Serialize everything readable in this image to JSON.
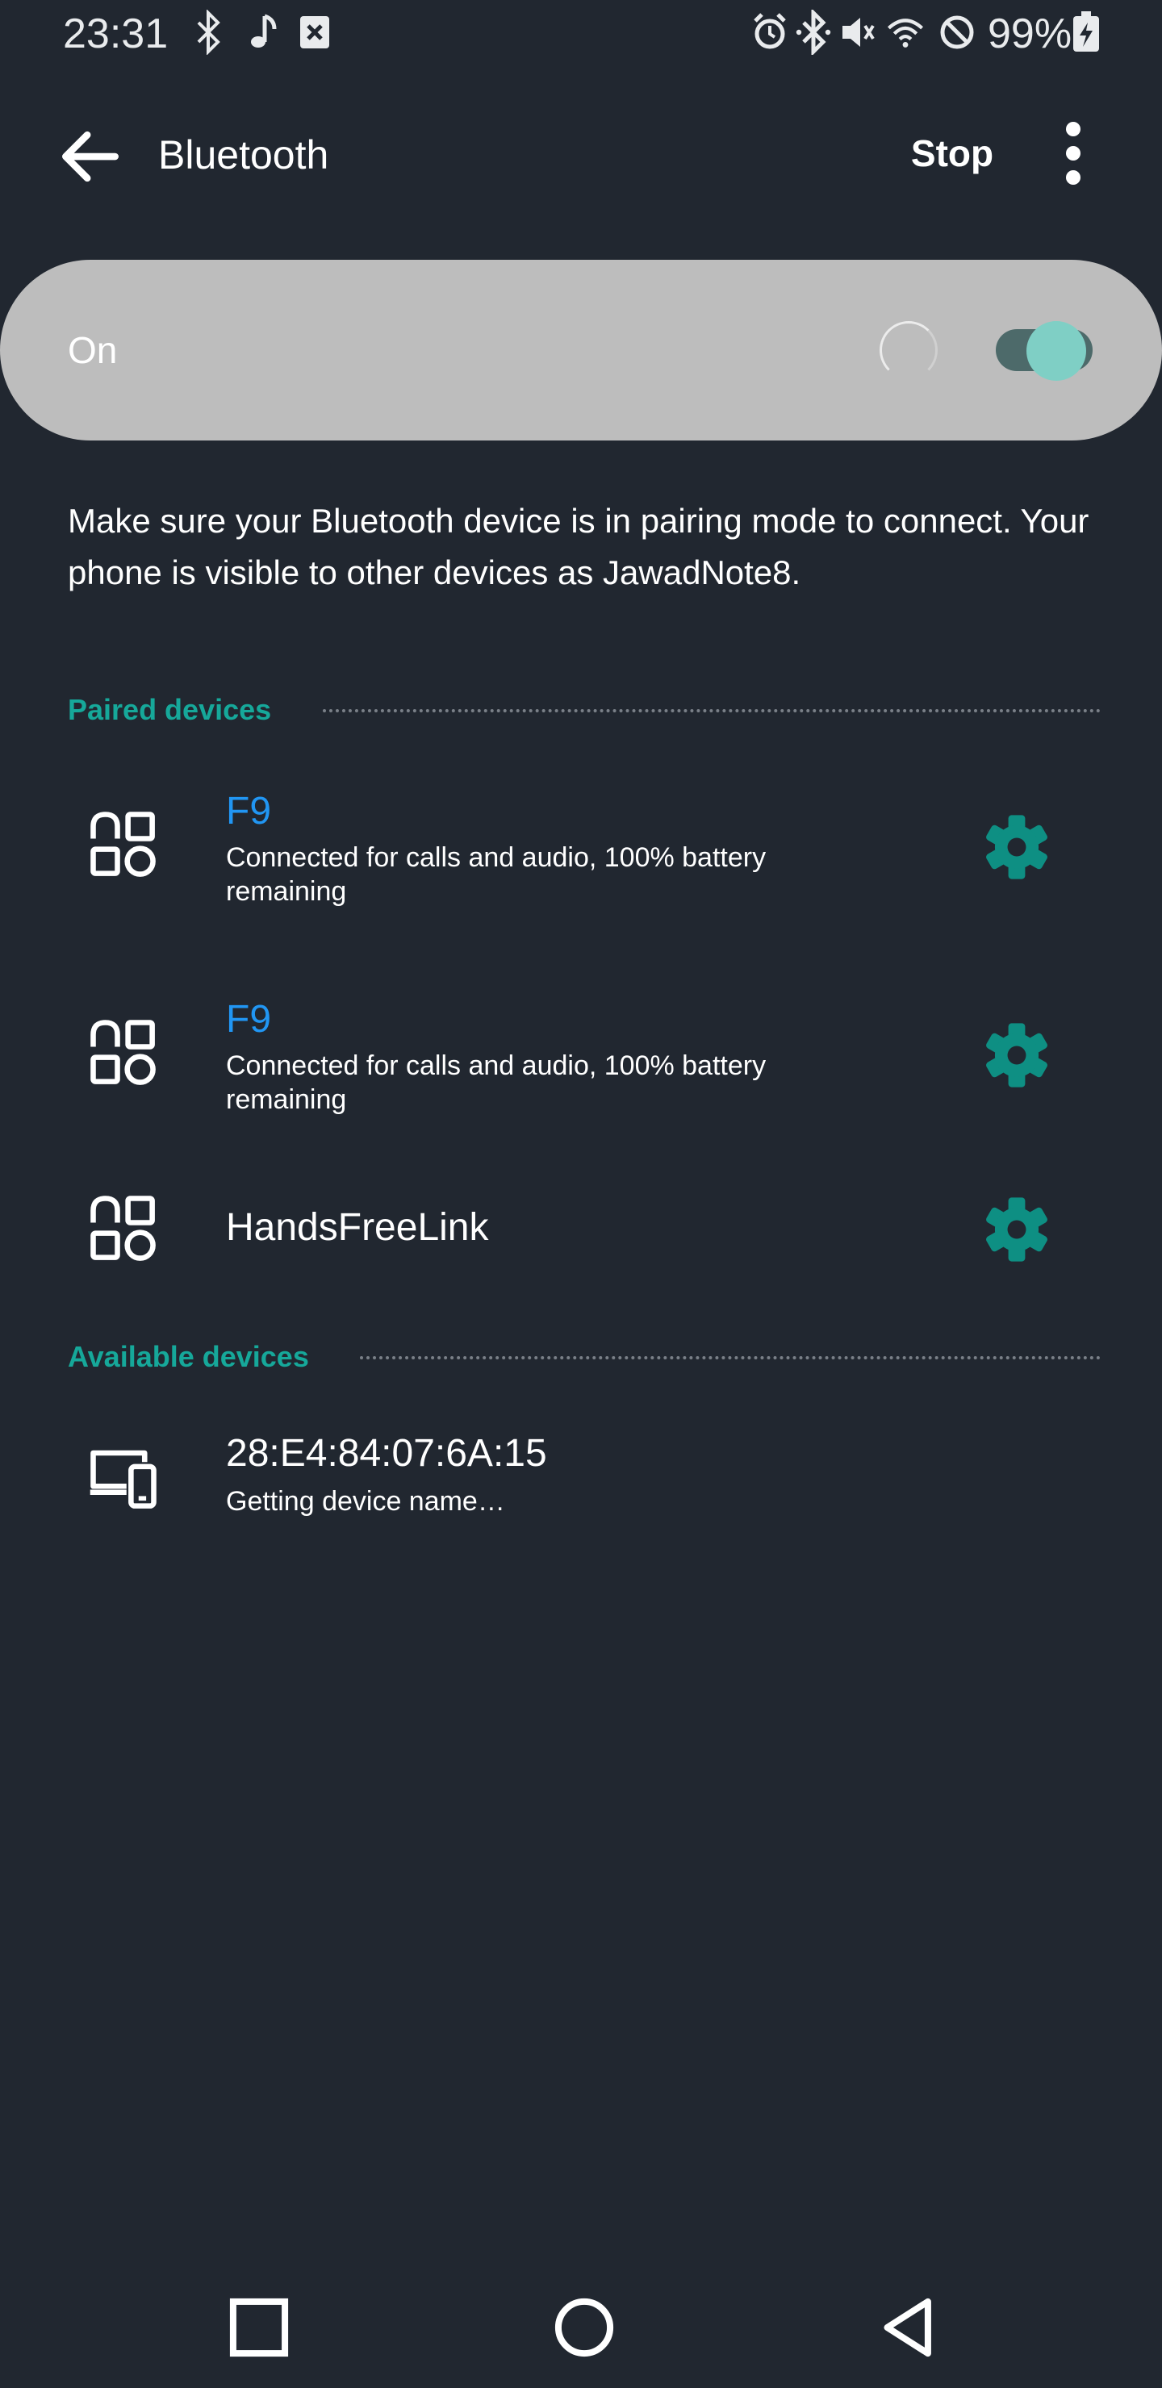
{
  "status_bar": {
    "time": "23:31",
    "battery": "99%",
    "left_icons": [
      "bluetooth-icon",
      "music-note-icon",
      "notification-x-icon"
    ],
    "right_icons": [
      "alarm-icon",
      "bluetooth-icon",
      "vibrate-mute-icon",
      "wifi-icon",
      "do-not-disturb-icon",
      "battery-charging-icon"
    ]
  },
  "app_bar": {
    "title": "Bluetooth",
    "stop_label": "Stop"
  },
  "toggle": {
    "label": "On",
    "state": true,
    "accent": "#7fcfc5"
  },
  "description": "Make sure your Bluetooth device is in pairing mode to connect. Your phone is visible to other devices as JawadNote8.",
  "paired": {
    "header": "Paired devices",
    "devices": [
      {
        "name": "F9",
        "status": "Connected for calls and audio, 100% battery remaining",
        "icon": "device-apps-icon"
      },
      {
        "name": "F9",
        "status": "Connected for calls and audio, 100% battery remaining",
        "icon": "device-apps-icon"
      },
      {
        "name": "HandsFreeLink",
        "status": "",
        "icon": "device-apps-icon"
      }
    ]
  },
  "available": {
    "header": "Available devices",
    "devices": [
      {
        "name": "28:E4:84:07:6A:15",
        "status": "Getting device name…",
        "icon": "computer-phone-icon"
      }
    ]
  },
  "colors": {
    "background": "#212730",
    "accent": "#16a89a",
    "connected": "#2196f3",
    "gear": "#0e8f83"
  }
}
